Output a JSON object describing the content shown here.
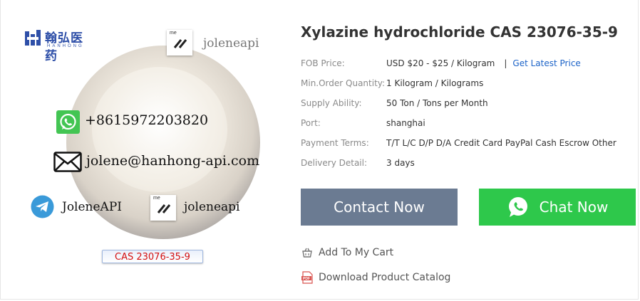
{
  "image_overlay": {
    "logo_cn": "翰弘医药",
    "logo_en": "HANHONG",
    "watermark_top": "joleneapi",
    "phone": "+8615972203820",
    "email": "jolene@hanhong-api.com",
    "telegram": "JoleneAPI",
    "me_handle": "joleneapi",
    "me_badge_text": "me",
    "cas_label": "CAS 23076-35-9"
  },
  "product": {
    "title": "Xylazine hydrochloride CAS 23076-35-9"
  },
  "specs": [
    {
      "label": "FOB Price:",
      "value": "USD $20 - $25 / Kilogram",
      "link": "Get Latest Price",
      "separator": "|"
    },
    {
      "label": "Min.Order Quantity:",
      "value": "1 Kilogram / Kilograms"
    },
    {
      "label": "Supply Ability:",
      "value": "50 Ton / Tons per Month"
    },
    {
      "label": "Port:",
      "value": "shanghai"
    },
    {
      "label": "Payment Terms:",
      "value": "T/T L/C D/P D/A Credit Card PayPal Cash Escrow Other"
    },
    {
      "label": "Delivery Detail:",
      "value": "3 days"
    }
  ],
  "buttons": {
    "contact_now": "Contact Now",
    "chat_now": "Chat Now"
  },
  "links": {
    "add_to_cart": "Add To My Cart",
    "download_catalog": "Download Product Catalog",
    "pdf_badge": "PDF"
  },
  "colors": {
    "contact_button": "#6b7b92",
    "chat_button": "#2ec84b",
    "link_blue": "#1c63c8",
    "cas_text": "#d41010"
  },
  "icons": [
    "whatsapp-icon",
    "mail-icon",
    "telegram-icon",
    "me-icon",
    "cart-icon",
    "pdf-icon"
  ]
}
